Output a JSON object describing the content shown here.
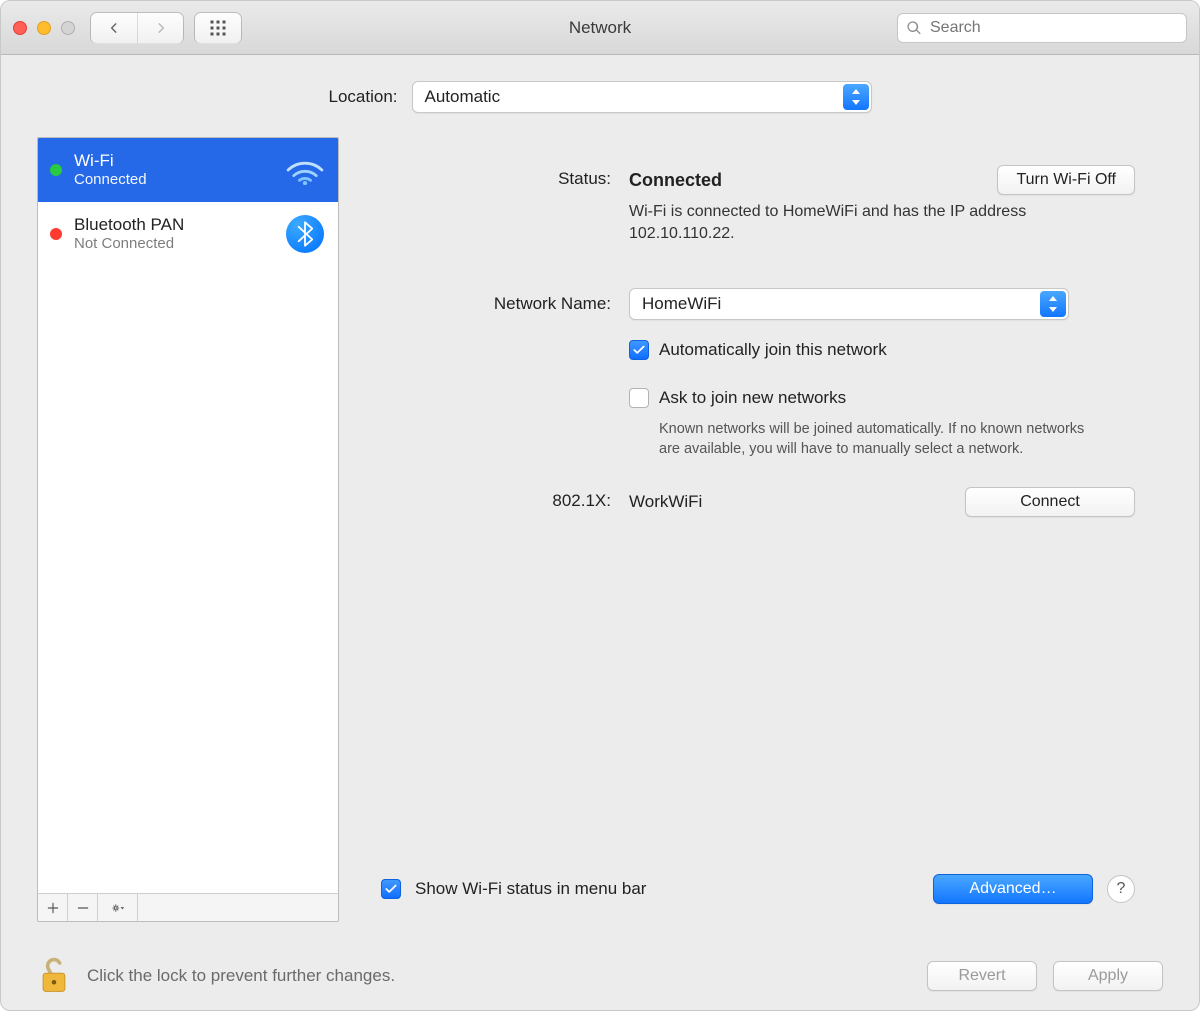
{
  "window": {
    "title": "Network"
  },
  "toolbar": {
    "search_placeholder": "Search"
  },
  "location": {
    "label": "Location:",
    "selected": "Automatic"
  },
  "sidebar": {
    "services": [
      {
        "name": "Wi-Fi",
        "status": "Connected",
        "dot_color": "#29c940",
        "selected": true,
        "icon": "wifi"
      },
      {
        "name": "Bluetooth PAN",
        "status": "Not Connected",
        "dot_color": "#ff3b30",
        "selected": false,
        "icon": "bluetooth"
      }
    ]
  },
  "main": {
    "status": {
      "label": "Status:",
      "value": "Connected",
      "toggle_button": "Turn Wi-Fi Off",
      "description": "Wi-Fi is connected to HomeWiFi and has the IP address 102.10.110.22."
    },
    "network_name": {
      "label": "Network Name:",
      "selected": "HomeWiFi"
    },
    "auto_join": {
      "checked": true,
      "label": "Automatically join this network"
    },
    "ask_join": {
      "checked": false,
      "label": "Ask to join new networks",
      "description": "Known networks will be joined automatically. If no known networks are available, you will have to manually select a network."
    },
    "dot1x": {
      "label": "802.1X:",
      "value": "WorkWiFi",
      "button": "Connect"
    },
    "show_menubar": {
      "checked": true,
      "label": "Show Wi-Fi status in menu bar"
    },
    "advanced_button": "Advanced…",
    "help_button": "?"
  },
  "footer": {
    "lock_text": "Click the lock to prevent further changes.",
    "revert_button": "Revert",
    "apply_button": "Apply"
  }
}
